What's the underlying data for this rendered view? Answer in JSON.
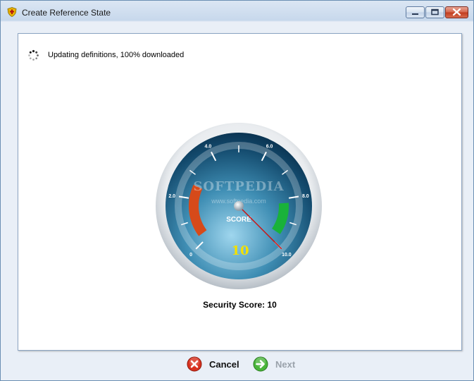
{
  "window": {
    "title": "Create Reference State",
    "controls": [
      "minimize",
      "maximize",
      "close"
    ]
  },
  "status": {
    "icon": "spinner-icon",
    "text": "Updating definitions, 100% downloaded"
  },
  "gauge": {
    "label": "SCORE",
    "value_text": "10",
    "value": 10,
    "min": 0,
    "max": 10,
    "ticks": [
      "0",
      "2.0",
      "4.0",
      "6.0",
      "8.0",
      "10.0"
    ],
    "watermark": "SOFTPEDIA",
    "watermark_url": "www.softpedia.com",
    "colors": {
      "low_zone": "#d64a1a",
      "high_zone": "#19b23a",
      "needle": "#cc1010",
      "value_text": "#f4e100"
    }
  },
  "score_caption": "Security Score: 10",
  "buttons": {
    "cancel": {
      "label": "Cancel",
      "icon": "cancel-icon"
    },
    "next": {
      "label": "Next",
      "icon": "next-arrow-icon",
      "enabled": false
    }
  }
}
